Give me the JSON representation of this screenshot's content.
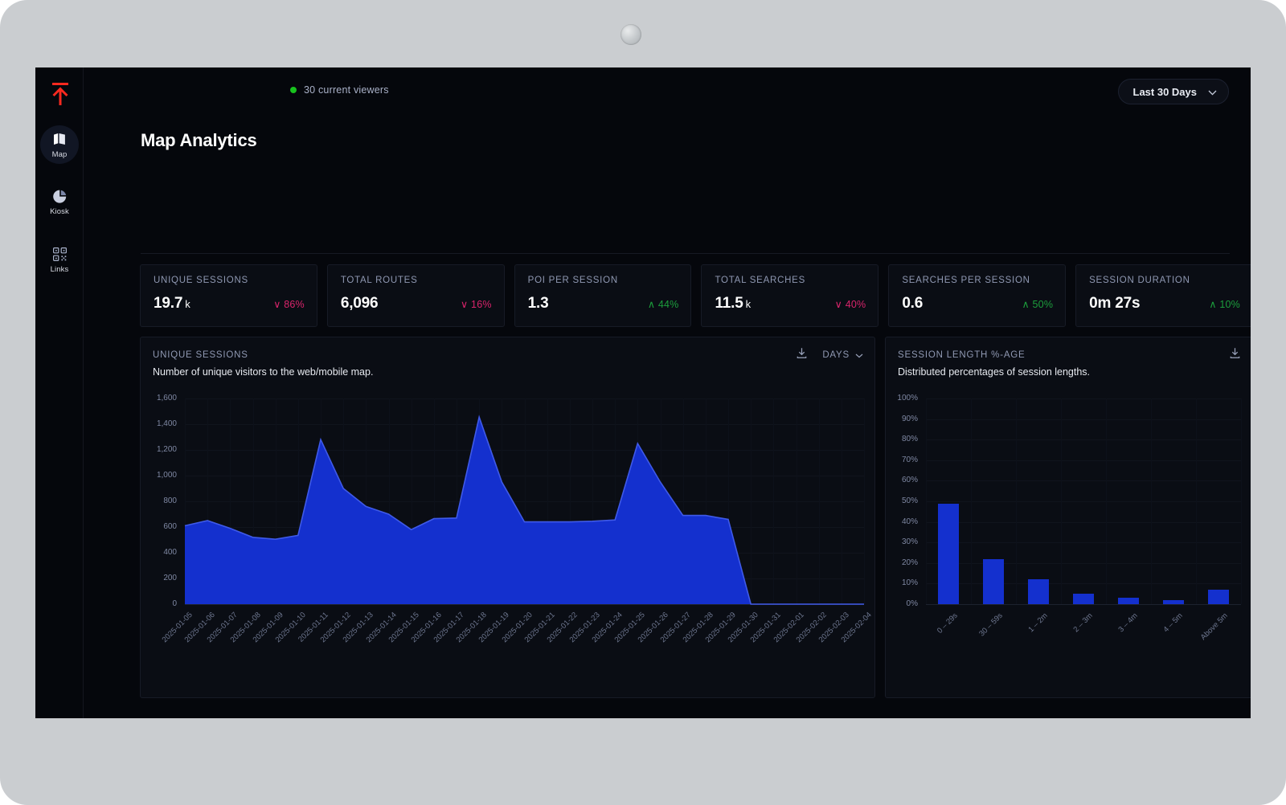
{
  "topbar": {
    "logo_icon": "arrow-up-to-line-icon",
    "viewers_text": "30 current viewers",
    "viewer_status_color": "#18c21e",
    "range_label": "Last 30 Days",
    "range_chevron_icon": "chevron-down-icon"
  },
  "sidebar": {
    "items": [
      {
        "label": "Map",
        "icon": "map-icon",
        "active": true
      },
      {
        "label": "Kiosk",
        "icon": "pie-chart-icon",
        "active": false
      },
      {
        "label": "Links",
        "icon": "qr-code-icon",
        "active": false
      }
    ]
  },
  "page": {
    "title": "Map Analytics"
  },
  "kpis": [
    {
      "label": "UNIQUE SESSIONS",
      "value": "19.7",
      "unit": "k",
      "delta": "86%",
      "direction": "down"
    },
    {
      "label": "TOTAL ROUTES",
      "value": "6,096",
      "unit": "",
      "delta": "16%",
      "direction": "down"
    },
    {
      "label": "POI PER SESSION",
      "value": "1.3",
      "unit": "",
      "delta": "44%",
      "direction": "up"
    },
    {
      "label": "TOTAL SEARCHES",
      "value": "11.5",
      "unit": "k",
      "delta": "40%",
      "direction": "down"
    },
    {
      "label": "SEARCHES PER SESSION",
      "value": "0.6",
      "unit": "",
      "delta": "50%",
      "direction": "up"
    },
    {
      "label": "SESSION DURATION",
      "value": "0m 27s",
      "unit": "",
      "delta": "10%",
      "direction": "up"
    }
  ],
  "panels": {
    "sessions": {
      "title": "UNIQUE SESSIONS",
      "subtitle": "Number of unique visitors to the web/mobile map.",
      "download_icon": "download-icon",
      "granularity_label": "DAYS",
      "granularity_chevron_icon": "chevron-down-icon"
    },
    "session_length": {
      "title": "SESSION LENGTH %-AGE",
      "subtitle": "Distributed percentages of session lengths.",
      "download_icon": "download-icon"
    }
  },
  "chart_data": [
    {
      "id": "unique-sessions",
      "type": "area",
      "title": "UNIQUE SESSIONS",
      "subtitle": "Number of unique visitors to the web/mobile map.",
      "xlabel": "",
      "ylabel": "",
      "ylim": [
        0,
        1600
      ],
      "yticks": [
        0,
        200,
        400,
        600,
        800,
        1000,
        1200,
        1400,
        1600
      ],
      "ytick_labels": [
        "0",
        "200",
        "400",
        "600",
        "800",
        "1,000",
        "1,200",
        "1,400",
        "1,600"
      ],
      "grid": true,
      "legend": "none",
      "series_color": "#1430ce",
      "x": [
        "2025-01-05",
        "2025-01-06",
        "2025-01-07",
        "2025-01-08",
        "2025-01-09",
        "2025-01-10",
        "2025-01-11",
        "2025-01-12",
        "2025-01-13",
        "2025-01-14",
        "2025-01-15",
        "2025-01-16",
        "2025-01-17",
        "2025-01-18",
        "2025-01-19",
        "2025-01-20",
        "2025-01-21",
        "2025-01-22",
        "2025-01-23",
        "2025-01-24",
        "2025-01-25",
        "2025-01-26",
        "2025-01-27",
        "2025-01-28",
        "2025-01-29",
        "2025-01-30",
        "2025-01-31",
        "2025-02-01",
        "2025-02-02",
        "2025-02-03",
        "2025-02-04"
      ],
      "values": [
        610,
        650,
        590,
        520,
        505,
        535,
        1280,
        900,
        760,
        700,
        580,
        665,
        670,
        1455,
        950,
        640,
        640,
        640,
        645,
        655,
        1250,
        950,
        690,
        690,
        660,
        0,
        0,
        0,
        0,
        0,
        0
      ]
    },
    {
      "id": "session-length-percentage",
      "type": "bar",
      "title": "SESSION LENGTH %-AGE",
      "subtitle": "Distributed percentages of session lengths.",
      "xlabel": "",
      "ylabel": "",
      "ylim": [
        0,
        100
      ],
      "yticks": [
        0,
        10,
        20,
        30,
        40,
        50,
        60,
        70,
        80,
        90,
        100
      ],
      "ytick_labels": [
        "0%",
        "10%",
        "20%",
        "30%",
        "40%",
        "50%",
        "60%",
        "70%",
        "80%",
        "90%",
        "100%"
      ],
      "grid": true,
      "legend": "none",
      "series_color": "#1430ce",
      "categories": [
        "0 – 29s",
        "30 – 59s",
        "1 – 2m",
        "2 – 3m",
        "3 – 4m",
        "4 – 5m",
        "Above 5m"
      ],
      "values": [
        49,
        22,
        12,
        5,
        3,
        2,
        7
      ]
    }
  ]
}
